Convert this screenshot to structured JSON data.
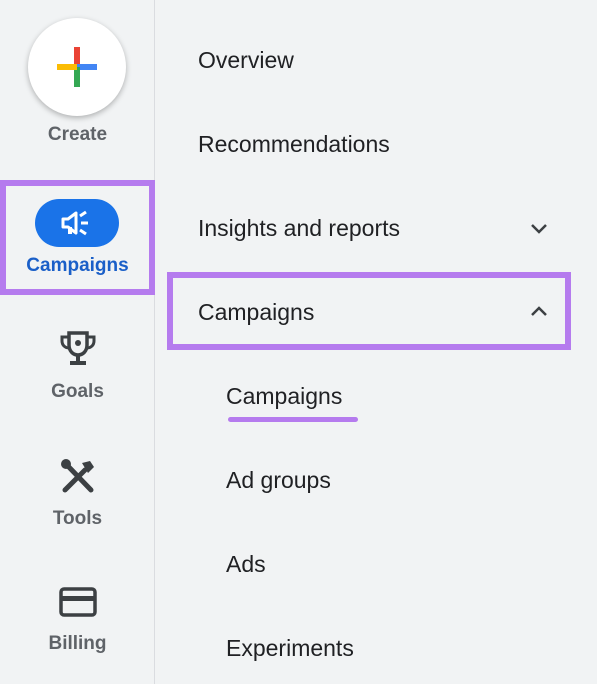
{
  "rail": {
    "create_label": "Create",
    "items": [
      {
        "label": "Campaigns",
        "icon": "megaphone-icon",
        "active": true
      },
      {
        "label": "Goals",
        "icon": "trophy-icon"
      },
      {
        "label": "Tools",
        "icon": "tools-icon"
      },
      {
        "label": "Billing",
        "icon": "credit-card-icon"
      }
    ]
  },
  "nav": {
    "items": [
      {
        "label": "Overview"
      },
      {
        "label": "Recommendations"
      },
      {
        "label": "Insights and reports",
        "chevron": "chevron-down-icon"
      },
      {
        "label": "Campaigns",
        "chevron": "chevron-up-icon",
        "expanded": true
      }
    ],
    "sub_items": [
      {
        "label": "Campaigns",
        "active": true
      },
      {
        "label": "Ad groups"
      },
      {
        "label": "Ads"
      },
      {
        "label": "Experiments"
      }
    ]
  },
  "colors": {
    "accent_blue": "#1a73e8",
    "highlight_purple": "#b57bee",
    "background": "#f1f3f4",
    "plus_colors": [
      "#ea4335",
      "#4285f4",
      "#34a853",
      "#fbbc04"
    ]
  }
}
